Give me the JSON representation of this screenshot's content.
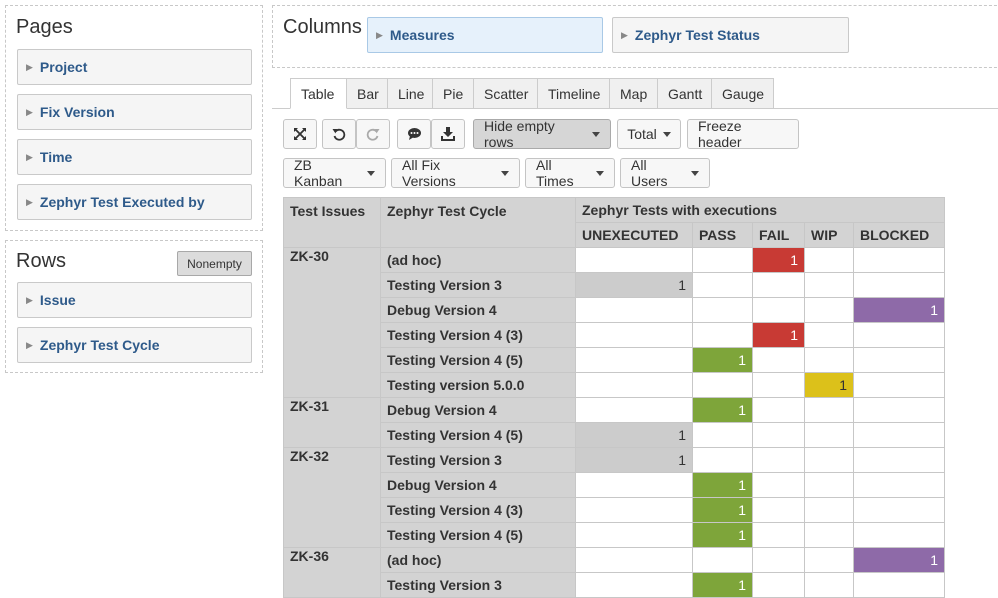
{
  "pages": {
    "title": "Pages",
    "items": [
      "Project",
      "Fix Version",
      "Time",
      "Zephyr Test Executed by"
    ]
  },
  "rows_panel": {
    "title": "Rows",
    "nonempty_label": "Nonempty",
    "items": [
      "Issue",
      "Zephyr Test Cycle"
    ]
  },
  "columns_panel": {
    "title": "Columns",
    "items": [
      "Measures",
      "Zephyr Test Status"
    ]
  },
  "tabs": [
    "Table",
    "Bar",
    "Line",
    "Pie",
    "Scatter",
    "Timeline",
    "Map",
    "Gantt",
    "Gauge"
  ],
  "toolbar": {
    "hide_empty_rows": "Hide empty rows",
    "total": "Total",
    "freeze_header": "Freeze header"
  },
  "filters": [
    "ZB Kanban",
    "All Fix Versions",
    "All Times",
    "All Users"
  ],
  "table": {
    "header_issues": "Test Issues",
    "header_cycle": "Zephyr Test Cycle",
    "header_group": "Zephyr Tests with executions",
    "statuses": [
      "UNEXECUTED",
      "PASS",
      "FAIL",
      "WIP",
      "BLOCKED"
    ],
    "groups": [
      {
        "issue": "ZK-30",
        "rows": [
          {
            "cycle": "(ad hoc)",
            "values": [
              "",
              "",
              "1",
              "",
              ""
            ]
          },
          {
            "cycle": "Testing Version 3",
            "values": [
              "1",
              "",
              "",
              "",
              ""
            ]
          },
          {
            "cycle": "Debug Version 4",
            "values": [
              "",
              "",
              "",
              "",
              "1"
            ]
          },
          {
            "cycle": "Testing Version 4 (3)",
            "values": [
              "",
              "",
              "1",
              "",
              ""
            ]
          },
          {
            "cycle": "Testing Version 4 (5)",
            "values": [
              "",
              "1",
              "",
              "",
              ""
            ]
          },
          {
            "cycle": "Testing version 5.0.0",
            "values": [
              "",
              "",
              "",
              "1",
              ""
            ]
          }
        ]
      },
      {
        "issue": "ZK-31",
        "rows": [
          {
            "cycle": "Debug Version 4",
            "values": [
              "",
              "1",
              "",
              "",
              ""
            ]
          },
          {
            "cycle": "Testing Version 4 (5)",
            "values": [
              "1",
              "",
              "",
              "",
              ""
            ]
          }
        ]
      },
      {
        "issue": "ZK-32",
        "rows": [
          {
            "cycle": "Testing Version 3",
            "values": [
              "1",
              "",
              "",
              "",
              ""
            ]
          },
          {
            "cycle": "Debug Version 4",
            "values": [
              "",
              "1",
              "",
              "",
              ""
            ]
          },
          {
            "cycle": "Testing Version 4 (3)",
            "values": [
              "",
              "1",
              "",
              "",
              ""
            ]
          },
          {
            "cycle": "Testing Version 4 (5)",
            "values": [
              "",
              "1",
              "",
              "",
              ""
            ]
          }
        ]
      },
      {
        "issue": "ZK-36",
        "rows": [
          {
            "cycle": "(ad hoc)",
            "values": [
              "",
              "",
              "",
              "",
              "1"
            ]
          },
          {
            "cycle": "Testing Version 3",
            "values": [
              "",
              "1",
              "",
              "",
              ""
            ]
          }
        ]
      }
    ]
  },
  "colors": {
    "UNEXECUTED": "#cccccc",
    "PASS": "#7ea53a",
    "FAIL": "#c83a34",
    "WIP": "#dcc11a",
    "BLOCKED": "#8e6aa8",
    "link": "#2e5a8a"
  }
}
